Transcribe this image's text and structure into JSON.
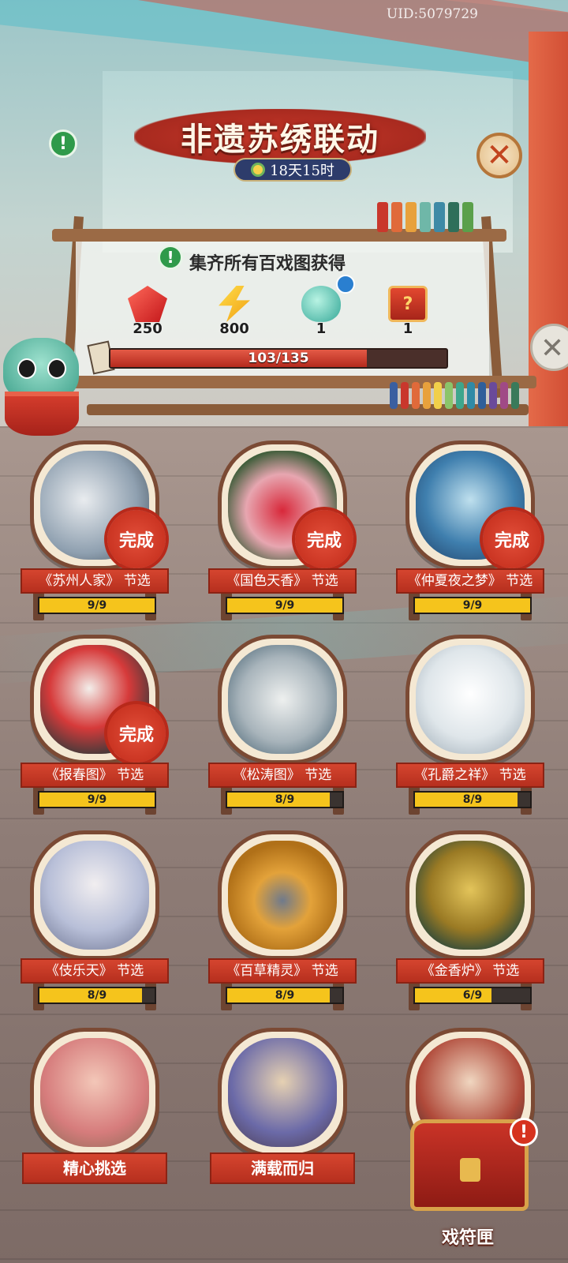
{
  "uid": "UID:5079729",
  "event": {
    "title": "非遗苏绣联动",
    "timer": "18天15时",
    "collect_label": "集齐所有百戏图获得"
  },
  "rewards": [
    {
      "icon": "ruby-gem-icon",
      "count": "250"
    },
    {
      "icon": "lightning-bolt-icon",
      "count": "800"
    },
    {
      "icon": "jade-gourd-icon",
      "count": "1"
    },
    {
      "icon": "mystery-chest-icon",
      "count": "1"
    }
  ],
  "progress": {
    "text": "103/135",
    "current": 103,
    "total": 135
  },
  "cards": [
    {
      "label": "《苏州人家》 节选",
      "progress": "9/9",
      "current": 9,
      "total": 9,
      "done": "完成"
    },
    {
      "label": "《国色天香》 节选",
      "progress": "9/9",
      "current": 9,
      "total": 9,
      "done": "完成"
    },
    {
      "label": "《仲夏夜之梦》 节选",
      "progress": "9/9",
      "current": 9,
      "total": 9,
      "done": "完成"
    },
    {
      "label": "《报春图》 节选",
      "progress": "9/9",
      "current": 9,
      "total": 9,
      "done": "完成"
    },
    {
      "label": "《松涛图》 节选",
      "progress": "8/9",
      "current": 8,
      "total": 9,
      "done": ""
    },
    {
      "label": "《孔爵之祥》 节选",
      "progress": "8/9",
      "current": 8,
      "total": 9,
      "done": ""
    },
    {
      "label": "《伎乐天》 节选",
      "progress": "8/9",
      "current": 8,
      "total": 9,
      "done": ""
    },
    {
      "label": "《百草精灵》 节选",
      "progress": "8/9",
      "current": 8,
      "total": 9,
      "done": ""
    },
    {
      "label": "《金香炉》 节选",
      "progress": "6/9",
      "current": 6,
      "total": 9,
      "done": ""
    }
  ],
  "bottom_cards": [
    {
      "label": "精心挑选"
    },
    {
      "label": "满载而归"
    }
  ],
  "chest": {
    "label": "戏符匣",
    "alert": "!"
  },
  "info_glyph": "!",
  "colors": {
    "accent_red": "#c7311f",
    "progress_yellow": "#f5c41c",
    "timer_blue": "#2d3c6b"
  }
}
